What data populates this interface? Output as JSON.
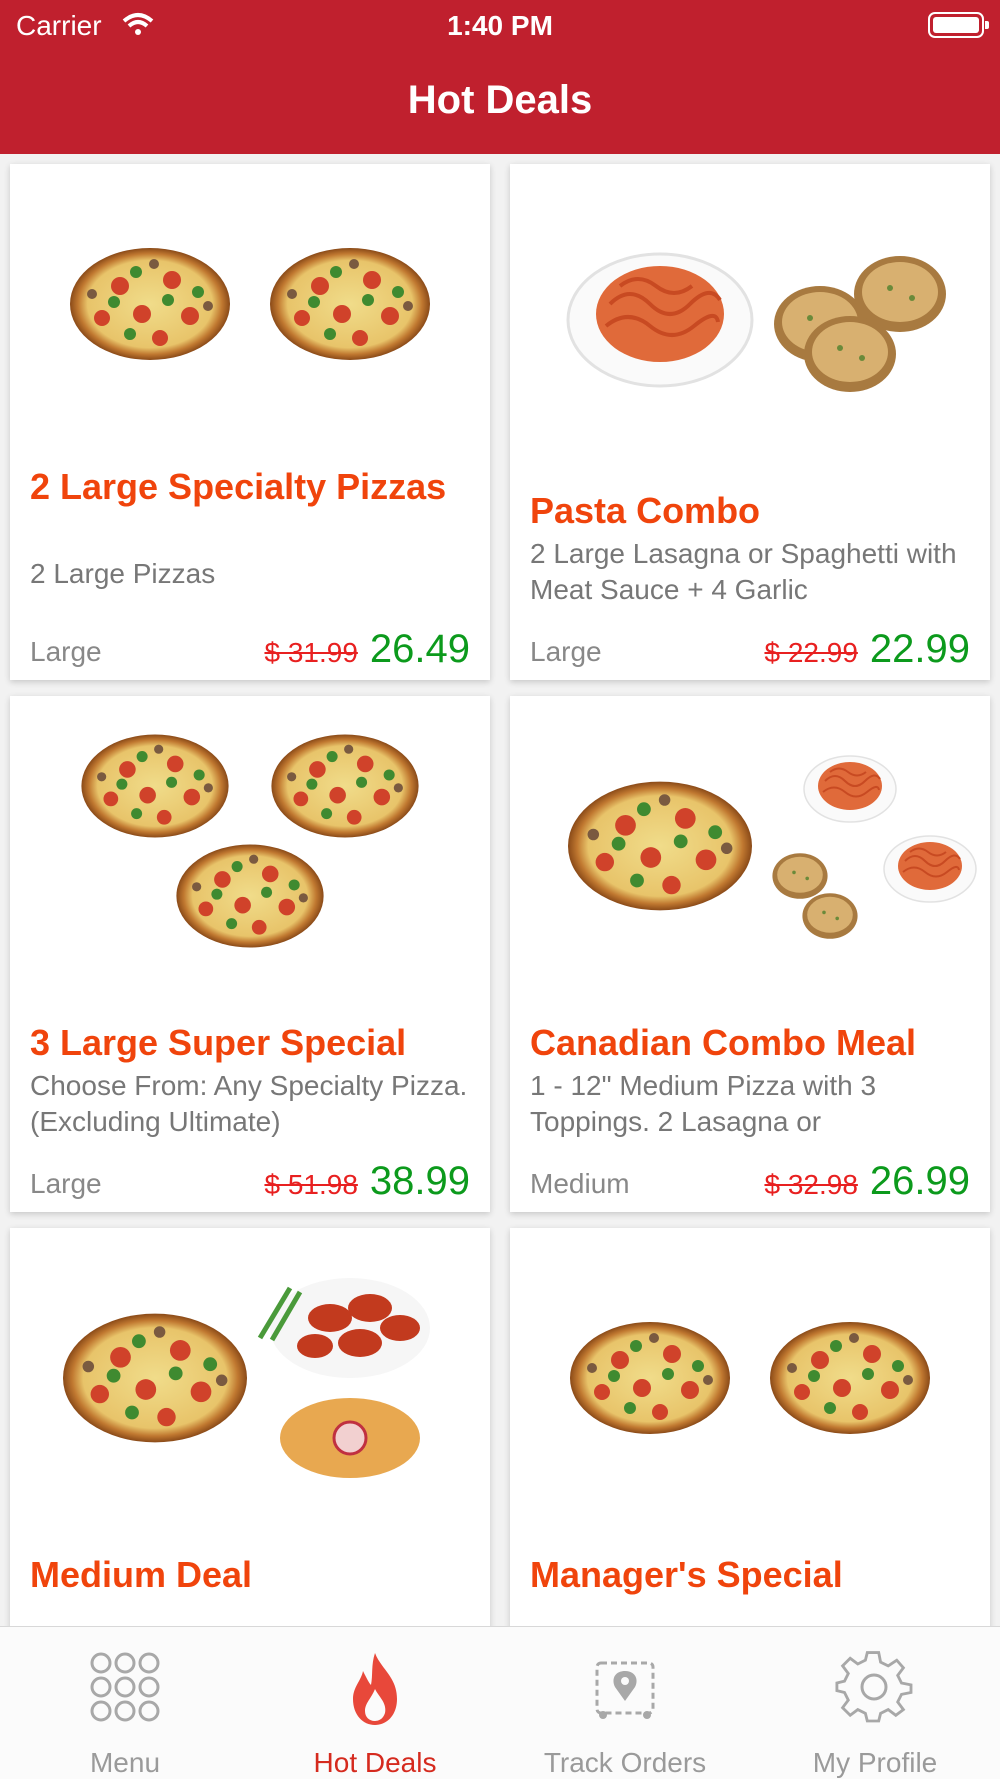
{
  "status_bar": {
    "carrier": "Carrier",
    "time": "1:40 PM"
  },
  "header": {
    "title": "Hot Deals"
  },
  "deals": [
    {
      "name": "2 Large Specialty Pizzas",
      "description": "2 Large Pizzas",
      "size": "Large",
      "old_price": "$ 31.99",
      "price": "26.49",
      "image": "two-pizzas"
    },
    {
      "name": "Pasta Combo",
      "description": "2  Large Lasagna or Spaghetti with Meat Sauce + 4 Garlic",
      "size": "Large",
      "old_price": "$ 22.99",
      "price": "22.99",
      "image": "pasta-garlic-bread"
    },
    {
      "name": "3 Large Super Special",
      "description": "Choose From: Any Specialty Pizza. (Excluding Ultimate)",
      "size": "Large",
      "old_price": "$ 51.98",
      "price": "38.99",
      "image": "three-pizzas"
    },
    {
      "name": "Canadian Combo Meal",
      "description": "1 - 12\" Medium Pizza with 3 Toppings. 2 Lasagna or",
      "size": "Medium",
      "old_price": "$ 32.98",
      "price": "26.99",
      "image": "pizza-pasta-bread"
    },
    {
      "name": "Medium Deal",
      "description": "",
      "size": "",
      "old_price": "",
      "price": "",
      "image": "pizza-wings-nuggets"
    },
    {
      "name": "Manager's Special",
      "description": "",
      "size": "",
      "old_price": "",
      "price": "",
      "image": "two-pizzas"
    }
  ],
  "tabs": [
    {
      "label": "Menu",
      "icon": "grid-dots-icon",
      "active": false
    },
    {
      "label": "Hot Deals",
      "icon": "flame-icon",
      "active": true
    },
    {
      "label": "Track Orders",
      "icon": "map-pin-icon",
      "active": false
    },
    {
      "label": "My Profile",
      "icon": "gear-icon",
      "active": false
    }
  ],
  "colors": {
    "brand_red": "#c0202e",
    "deal_title": "#f0440c",
    "old_price": "#e82020",
    "new_price": "#0c9a1c",
    "active_tab": "#d52a1e"
  }
}
